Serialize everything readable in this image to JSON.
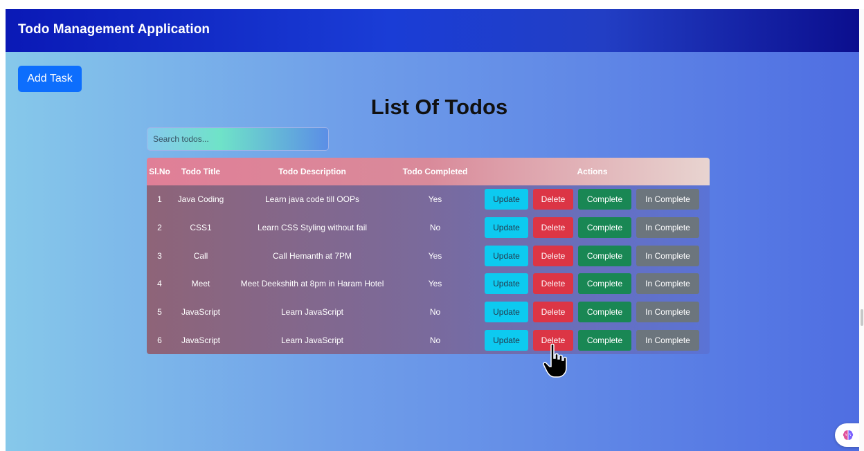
{
  "header": {
    "title": "Todo Management Application"
  },
  "add_task_label": "Add Task",
  "page_title": "List Of Todos",
  "search": {
    "placeholder": "Search todos...",
    "value": ""
  },
  "table": {
    "headers": [
      "Sl.No",
      "Todo Title",
      "Todo Description",
      "Todo Completed",
      "Actions"
    ],
    "rows": [
      {
        "sl": "1",
        "title": "Java Coding",
        "description": "Learn java code till OOPs",
        "completed": "Yes"
      },
      {
        "sl": "2",
        "title": "CSS1",
        "description": "Learn CSS Styling without fail",
        "completed": "No"
      },
      {
        "sl": "3",
        "title": "Call",
        "description": "Call Hemanth at 7PM",
        "completed": "Yes"
      },
      {
        "sl": "4",
        "title": "Meet",
        "description": "Meet Deekshith at 8pm in Haram Hotel",
        "completed": "Yes"
      },
      {
        "sl": "5",
        "title": "JavaScript",
        "description": "Learn JavaScript",
        "completed": "No"
      },
      {
        "sl": "6",
        "title": "JavaScript",
        "description": "Learn JavaScript",
        "completed": "No"
      }
    ],
    "actions": {
      "update": "Update",
      "delete": "Delete",
      "complete": "Complete",
      "incomplete": "In Complete"
    }
  },
  "colors": {
    "primary": "#0d6efd",
    "update": "#0dcaf0",
    "delete": "#dc3545",
    "complete": "#198754",
    "incomplete": "#6c757d",
    "topbar": "#0a19b6"
  },
  "icons": {
    "cursor": "hand-pointer-icon",
    "fab": "brain-icon"
  }
}
